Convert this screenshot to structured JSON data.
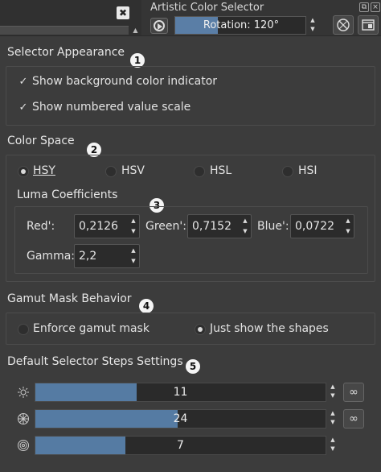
{
  "topbar": {
    "close_glyph": "✖",
    "dock_title": "Artistic Color Selector",
    "rotation_label": "Rotation: 120°",
    "rotation_degrees": 120,
    "rotation_fill_fraction": 0.33
  },
  "icons": {
    "close": "close-icon",
    "play": "play-icon",
    "reset": "reset-wheel-icon",
    "settings": "settings-panel-icon",
    "infinity": "infinity-icon",
    "hue_steps": "sun-icon",
    "saturation_steps": "wheel-icon",
    "value_steps": "rings-icon"
  },
  "selector_appearance": {
    "title": "Selector Appearance",
    "badge": "1",
    "show_bg_indicator": {
      "label": "Show background color indicator",
      "checked": true
    },
    "show_value_scale": {
      "label": "Show numbered value scale",
      "checked": true
    }
  },
  "color_space": {
    "title": "Color Space",
    "badge": "2",
    "options": [
      {
        "label": "HSY",
        "selected": true
      },
      {
        "label": "HSV",
        "selected": false
      },
      {
        "label": "HSL",
        "selected": false
      },
      {
        "label": "HSI",
        "selected": false
      }
    ],
    "luma": {
      "title": "Luma Coefficients",
      "badge": "3",
      "red_label": "Red':",
      "red_value": "0,2126",
      "green_label": "Green':",
      "green_value": "0,7152",
      "blue_label": "Blue':",
      "blue_value": "0,0722",
      "gamma_label": "Gamma:",
      "gamma_value": "2,2"
    }
  },
  "gamut_mask": {
    "title": "Gamut Mask Behavior",
    "badge": "4",
    "enforce_label": "Enforce gamut mask",
    "enforce_selected": false,
    "just_show_label": "Just show the shapes",
    "just_show_selected": true
  },
  "steps": {
    "title": "Default Selector Steps Settings",
    "badge": "5",
    "infinity_glyph": "∞",
    "rows": [
      {
        "value": "11",
        "fill_fraction": 0.35
      },
      {
        "value": "24",
        "fill_fraction": 0.49
      },
      {
        "value": "7",
        "fill_fraction": 0.31
      }
    ]
  },
  "colors": {
    "background": "#3c3c3c",
    "accent_fill": "#557ba3",
    "field_bg": "#2b2b2b"
  }
}
